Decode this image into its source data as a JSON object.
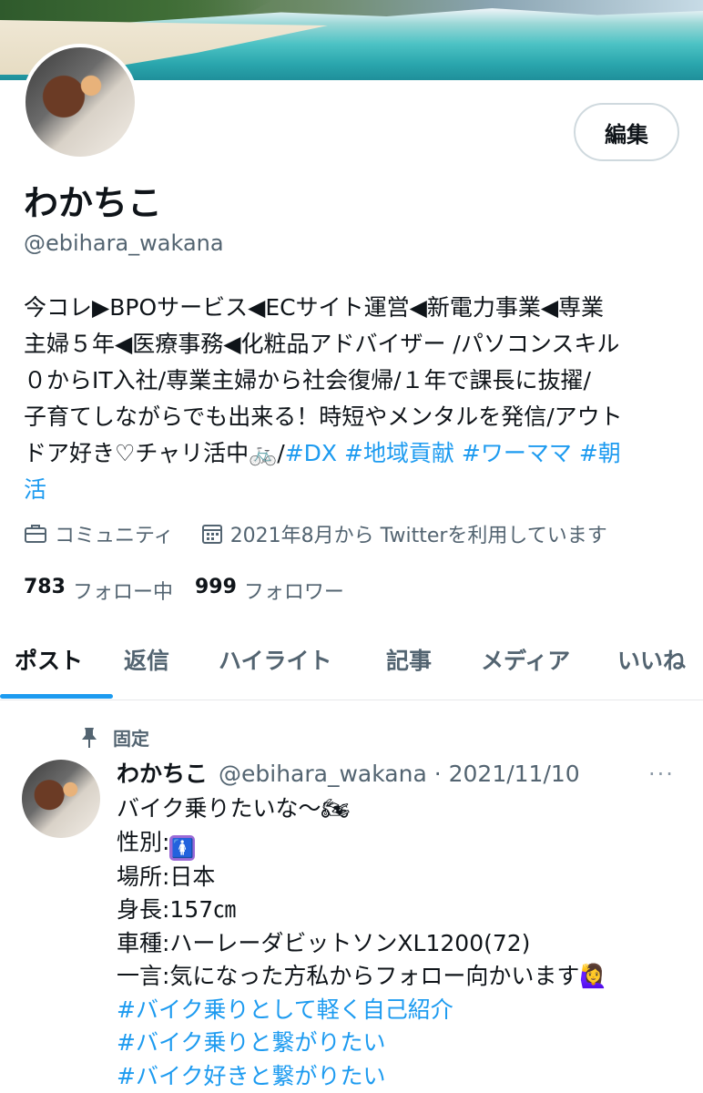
{
  "profile": {
    "name": "わかちこ",
    "handle": "@ebihara_wakana",
    "edit_label": "編集",
    "bio_lines": [
      "今コレ▶︎BPOサービス◀︎ECサイト運営◀︎新電力事業◀︎専業",
      "主婦５年◀︎医療事務◀︎化粧品アドバイザー /パソコンスキル",
      "０からIT入社/専業主婦から社会復帰/１年で課長に抜擢/",
      "子育てしながらでも出来る！時短やメンタルを発信/アウト"
    ],
    "bio_last_line_text": "ドア好き♡チャリ活中🚲/",
    "bio_hashtags": [
      "#DX",
      "#地域貢献",
      "#ワーママ",
      "#朝"
    ],
    "bio_wrap": "活",
    "category": "コミュニティ",
    "joined": "2021年8月から Twitterを利用しています",
    "following_count": "783",
    "following_label": "フォロー中",
    "followers_count": "999",
    "followers_label": "フォロワー",
    "category_icon": "briefcase-icon",
    "joined_icon": "calendar-icon"
  },
  "tabs": [
    "ポスト",
    "返信",
    "ハイライト",
    "記事",
    "メディア",
    "いいね"
  ],
  "active_tab": "ポスト",
  "accent_color": "#1d9bf0",
  "pinned": {
    "label": "固定",
    "author_name": "わかちこ",
    "author_handle_date": "@ebihara_wakana · 2021/11/10",
    "more": "···",
    "lines": [
      "バイク乗りたいな〜🏍",
      "性別:",
      "場所:日本",
      "身長:157㎝",
      "車種:ハーレーダビットソンXL1200(72)",
      "一言:気になった方私からフォロー向かいます🙋‍♀️"
    ],
    "gender_emoji": "🚺",
    "hashtags": [
      "#バイク乗りとして軽く自己紹介",
      "#バイク乗りと繋がりたい",
      "#バイク好きと繋がりたい"
    ]
  }
}
